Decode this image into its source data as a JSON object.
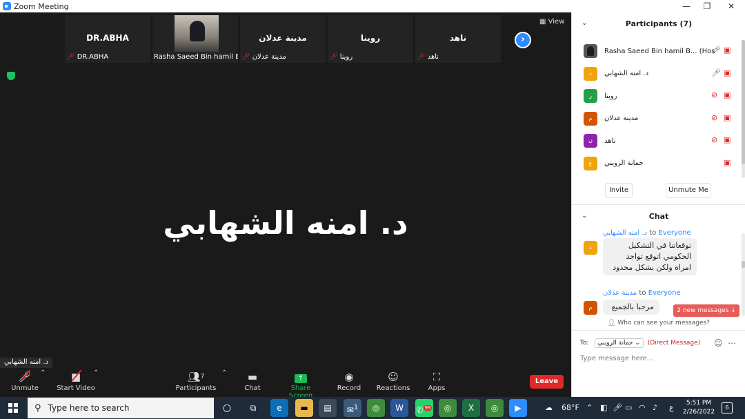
{
  "window": {
    "title": "Zoom Meeting",
    "minimize": "—",
    "restore": "❐",
    "close": "✕"
  },
  "gallery": {
    "view_label": "View",
    "tiles": [
      {
        "display": "DR.ABHA",
        "label": "DR.ABHA"
      },
      {
        "display": "",
        "label": "Rasha Saeed Bin hamil B..."
      },
      {
        "display": "مدينة عدلان",
        "label": "مدينة عدلان"
      },
      {
        "display": "روينا",
        "label": "روينا"
      },
      {
        "display": "ناهد",
        "label": "ناهد"
      }
    ]
  },
  "speaker": {
    "name": "د. امنه الشهابي",
    "name_tag": "د. امنه الشهابي"
  },
  "toolbar": {
    "unmute": "Unmute",
    "start_video": "Start Video",
    "participants": "Participants",
    "participants_count": "7",
    "chat": "Chat",
    "share_screen": "Share Screen",
    "record": "Record",
    "reactions": "Reactions",
    "apps": "Apps",
    "leave": "Leave"
  },
  "participants_panel": {
    "title": "Participants (7)",
    "list": [
      {
        "initial": "",
        "name": "Rasha Saeed Bin hamil B... (Host)",
        "color": "#555555"
      },
      {
        "initial": "د",
        "name": "د. امنه الشهابي",
        "color": "#f0a30a"
      },
      {
        "initial": "ر",
        "name": "روينا",
        "color": "#24a148"
      },
      {
        "initial": "م",
        "name": "مدينة عدلان",
        "color": "#d35400"
      },
      {
        "initial": "ن",
        "name": "ناهد",
        "color": "#8e24aa"
      },
      {
        "initial": "ج",
        "name": "جمانة الرويني",
        "color": "#f0a30a"
      }
    ],
    "invite": "Invite",
    "unmute_me": "Unmute Me"
  },
  "chat_panel": {
    "title": "Chat",
    "messages": [
      {
        "from": "د. امنه الشهابي",
        "to_label": "to",
        "to": "Everyone",
        "initial": "د",
        "color": "#f0a30a",
        "lines": [
          "توقعاتنا في التشكيل",
          "الحكومي اتوقع تواجد",
          "امراه ولكن بشكل محدود"
        ]
      },
      {
        "from": "مدينة عدلان",
        "to_label": "to",
        "to": "Everyone",
        "initial": "م",
        "color": "#d35400",
        "lines": [
          "مرحبا بالجميع"
        ]
      }
    ],
    "new_messages": "2 new messages ↓",
    "privacy": "Who can see your messages?",
    "to_label": "To:",
    "recipient": "جمانة الرويني",
    "direct_message": "(Direct Message)",
    "input_placeholder": "Type message here..."
  },
  "taskbar": {
    "search_placeholder": "Type here to search",
    "weather": "68°F",
    "lang": "ع",
    "time": "5:51 PM",
    "date": "2/26/2022",
    "notifications": "6",
    "whatsapp_badge": "99",
    "mail_badge": "1"
  }
}
